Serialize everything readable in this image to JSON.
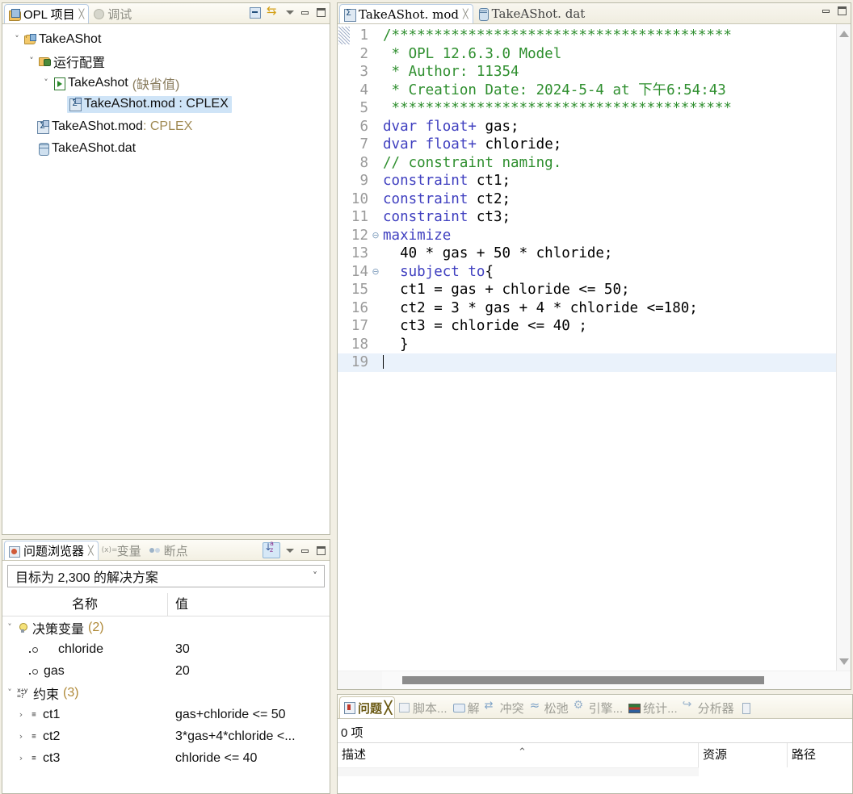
{
  "project_view": {
    "tabs": [
      {
        "label": "OPL 项目",
        "icon": "opl-project-icon",
        "active": true,
        "closeable": true
      },
      {
        "label": "调试",
        "icon": "debug-icon",
        "active": false,
        "closeable": false
      }
    ],
    "toolbar": [
      {
        "name": "collapse-all-icon"
      },
      {
        "name": "link-with-editor-icon"
      },
      {
        "name": "view-menu-icon"
      },
      {
        "name": "minimize-icon"
      },
      {
        "name": "maximize-icon"
      }
    ],
    "tree": [
      {
        "label": "TakeAShot",
        "icon": "opl-project-icon",
        "twisty": "expanded",
        "depth": 0
      },
      {
        "label": "运行配置",
        "icon": "run-configuration-folder-icon",
        "twisty": "expanded",
        "depth": 1
      },
      {
        "label": "TakeAshot",
        "sublabel": "(缺省值)",
        "icon": "run-config-icon",
        "twisty": "expanded",
        "depth": 2
      },
      {
        "label": "TakeAShot.mod : CPLEX",
        "icon": "model-icon",
        "twisty": "none",
        "depth": 3,
        "selected": true
      },
      {
        "label": "TakeAShot.mod",
        "suffix": " : CPLEX",
        "icon": "model-icon",
        "twisty": "none",
        "depth": 1
      },
      {
        "label": "TakeAShot.dat",
        "icon": "data-icon",
        "twisty": "none",
        "depth": 1
      }
    ]
  },
  "problem_browser": {
    "tabs": [
      {
        "label": "问题浏览器",
        "icon": "problem-browser-icon",
        "active": true,
        "closeable": true
      },
      {
        "label": "变量",
        "icon": "variables-icon",
        "active": false,
        "closeable": false
      },
      {
        "label": "断点",
        "icon": "breakpoints-icon",
        "active": false,
        "closeable": false
      }
    ],
    "toolbar": [
      {
        "name": "sort-az-icon"
      },
      {
        "name": "view-menu-icon"
      },
      {
        "name": "minimize-icon"
      },
      {
        "name": "maximize-icon"
      }
    ],
    "solution_selector": {
      "value": "目标为 2,300 的解决方案",
      "chevron": "chevron-down-icon"
    },
    "columns": {
      "name": "名称",
      "value": "值"
    },
    "rows": [
      {
        "type": "group",
        "twisty": "expanded",
        "icon": "decision-variable-group-icon",
        "name": "决策变量",
        "count": "(2)",
        "value": ""
      },
      {
        "type": "leaf",
        "icon": "variable-icon",
        "name": "chloride",
        "value": "30"
      },
      {
        "type": "leaf",
        "icon": "variable-icon",
        "name": "gas",
        "value": "20"
      },
      {
        "type": "group",
        "twisty": "expanded",
        "icon": "constraint-group-icon",
        "name": "约束",
        "count": "(3)",
        "value": ""
      },
      {
        "type": "leaf",
        "twisty": "collapsed",
        "icon": "constraint-icon",
        "name": "ct1",
        "value": "gas+chloride <= 50"
      },
      {
        "type": "leaf",
        "twisty": "collapsed",
        "icon": "constraint-icon",
        "name": "ct2",
        "value": "3*gas+4*chloride <..."
      },
      {
        "type": "leaf",
        "twisty": "collapsed",
        "icon": "constraint-icon",
        "name": "ct3",
        "value": "chloride <= 40"
      }
    ]
  },
  "editor": {
    "tabs": [
      {
        "label": "TakeAShot. mod",
        "icon": "model-file-icon",
        "active": true,
        "closeable": true
      },
      {
        "label": "TakeAShot. dat",
        "icon": "data-file-icon",
        "active": false,
        "closeable": false
      }
    ],
    "toolbar": [
      {
        "name": "minimize-icon"
      },
      {
        "name": "maximize-icon"
      }
    ],
    "lines": [
      {
        "n": "1",
        "fold": "",
        "segs": [
          {
            "t": "/****************************************",
            "c": "comment"
          }
        ]
      },
      {
        "n": "2",
        "fold": "",
        "segs": [
          {
            "t": " * OPL 12.6.3.0 Model",
            "c": "comment"
          }
        ]
      },
      {
        "n": "3",
        "fold": "",
        "segs": [
          {
            "t": " * Author: 11354",
            "c": "comment"
          }
        ]
      },
      {
        "n": "4",
        "fold": "",
        "segs": [
          {
            "t": " * Creation Date: 2024-5-4 at 下午6:54:43",
            "c": "comment"
          }
        ]
      },
      {
        "n": "5",
        "fold": "",
        "segs": [
          {
            "t": " ****************************************",
            "c": "comment"
          }
        ]
      },
      {
        "n": "6",
        "fold": "",
        "segs": [
          {
            "t": "dvar float+",
            "c": "keyword"
          },
          {
            "t": " gas;",
            "c": "plain"
          }
        ]
      },
      {
        "n": "7",
        "fold": "",
        "segs": [
          {
            "t": "dvar float+",
            "c": "keyword"
          },
          {
            "t": " chloride;",
            "c": "plain"
          }
        ]
      },
      {
        "n": "8",
        "fold": "",
        "segs": [
          {
            "t": "// constraint naming.",
            "c": "comment"
          }
        ]
      },
      {
        "n": "9",
        "fold": "",
        "segs": [
          {
            "t": "constraint",
            "c": "keyword"
          },
          {
            "t": " ct1;",
            "c": "plain"
          }
        ]
      },
      {
        "n": "10",
        "fold": "",
        "segs": [
          {
            "t": "constraint",
            "c": "keyword"
          },
          {
            "t": " ct2;",
            "c": "plain"
          }
        ]
      },
      {
        "n": "11",
        "fold": "",
        "segs": [
          {
            "t": "constraint",
            "c": "keyword"
          },
          {
            "t": " ct3;",
            "c": "plain"
          }
        ]
      },
      {
        "n": "12",
        "fold": "⊖",
        "segs": [
          {
            "t": "maximize",
            "c": "keyword"
          }
        ]
      },
      {
        "n": "13",
        "fold": "",
        "segs": [
          {
            "t": "  40 * gas + 50 * chloride;",
            "c": "plain"
          }
        ]
      },
      {
        "n": "14",
        "fold": "⊖",
        "segs": [
          {
            "t": "  ",
            "c": "plain"
          },
          {
            "t": "subject to",
            "c": "keyword"
          },
          {
            "t": "{",
            "c": "plain"
          }
        ]
      },
      {
        "n": "15",
        "fold": "",
        "segs": [
          {
            "t": "  ct1 = gas + chloride <= 50;",
            "c": "plain"
          }
        ]
      },
      {
        "n": "16",
        "fold": "",
        "segs": [
          {
            "t": "  ct2 = 3 * gas + 4 * chloride <=180;",
            "c": "plain"
          }
        ]
      },
      {
        "n": "17",
        "fold": "",
        "segs": [
          {
            "t": "  ct3 = chloride <= 40 ;",
            "c": "plain"
          }
        ]
      },
      {
        "n": "18",
        "fold": "",
        "segs": [
          {
            "t": "  }",
            "c": "plain"
          }
        ]
      },
      {
        "n": "19",
        "fold": "",
        "segs": [],
        "current": true,
        "caret": true
      }
    ]
  },
  "problems_view": {
    "tabs": [
      {
        "label": "问题",
        "icon": "problems-icon",
        "active": true,
        "closeable": true
      },
      {
        "label": "脚本...",
        "icon": "script-icon",
        "active": false,
        "closeable": false
      },
      {
        "label": "解",
        "icon": "solution-icon",
        "active": false,
        "closeable": false
      },
      {
        "label": "冲突",
        "icon": "conflict-icon",
        "active": false,
        "closeable": false
      },
      {
        "label": "松弛",
        "icon": "relaxation-icon",
        "active": false,
        "closeable": false
      },
      {
        "label": "引擎...",
        "icon": "engine-icon",
        "active": false,
        "closeable": false
      },
      {
        "label": "统计...",
        "icon": "statistics-icon",
        "active": false,
        "closeable": false
      },
      {
        "label": "分析器",
        "icon": "profiler-icon",
        "active": false,
        "closeable": false
      },
      {
        "label": "",
        "icon": "more-tabs-icon",
        "active": false,
        "closeable": false
      }
    ],
    "item_count": "0 项",
    "columns": [
      {
        "label": "描述",
        "sorted": true
      },
      {
        "label": "资源",
        "sorted": false
      },
      {
        "label": "路径",
        "sorted": false
      }
    ],
    "rows": []
  },
  "colors": {
    "selection": "#cfe4f7",
    "comment_green": "#2f8f2f",
    "keyword_blue": "#4040c0",
    "line_number_gray": "#9a9a9a",
    "current_line": "#eaf2fb",
    "tab_active_border": "#b8cce4",
    "panel_background": "#f2efe4"
  }
}
